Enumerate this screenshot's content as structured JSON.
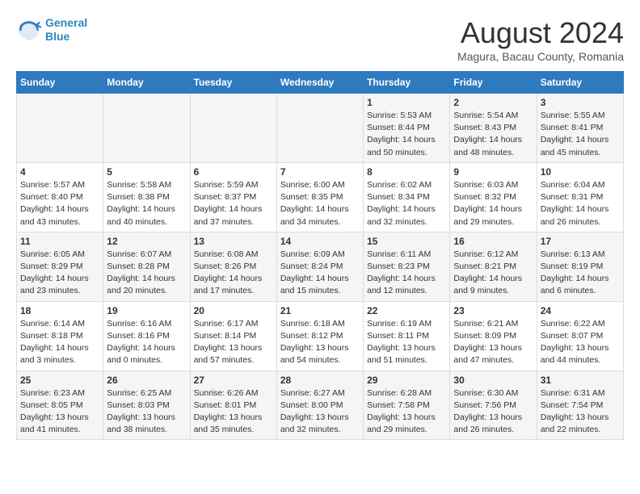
{
  "logo": {
    "line1": "General",
    "line2": "Blue"
  },
  "title": "August 2024",
  "subtitle": "Magura, Bacau County, Romania",
  "weekdays": [
    "Sunday",
    "Monday",
    "Tuesday",
    "Wednesday",
    "Thursday",
    "Friday",
    "Saturday"
  ],
  "weeks": [
    [
      {
        "day": "",
        "sunrise": "",
        "sunset": "",
        "daylight": ""
      },
      {
        "day": "",
        "sunrise": "",
        "sunset": "",
        "daylight": ""
      },
      {
        "day": "",
        "sunrise": "",
        "sunset": "",
        "daylight": ""
      },
      {
        "day": "",
        "sunrise": "",
        "sunset": "",
        "daylight": ""
      },
      {
        "day": "1",
        "sunrise": "Sunrise: 5:53 AM",
        "sunset": "Sunset: 8:44 PM",
        "daylight": "Daylight: 14 hours and 50 minutes."
      },
      {
        "day": "2",
        "sunrise": "Sunrise: 5:54 AM",
        "sunset": "Sunset: 8:43 PM",
        "daylight": "Daylight: 14 hours and 48 minutes."
      },
      {
        "day": "3",
        "sunrise": "Sunrise: 5:55 AM",
        "sunset": "Sunset: 8:41 PM",
        "daylight": "Daylight: 14 hours and 45 minutes."
      }
    ],
    [
      {
        "day": "4",
        "sunrise": "Sunrise: 5:57 AM",
        "sunset": "Sunset: 8:40 PM",
        "daylight": "Daylight: 14 hours and 43 minutes."
      },
      {
        "day": "5",
        "sunrise": "Sunrise: 5:58 AM",
        "sunset": "Sunset: 8:38 PM",
        "daylight": "Daylight: 14 hours and 40 minutes."
      },
      {
        "day": "6",
        "sunrise": "Sunrise: 5:59 AM",
        "sunset": "Sunset: 8:37 PM",
        "daylight": "Daylight: 14 hours and 37 minutes."
      },
      {
        "day": "7",
        "sunrise": "Sunrise: 6:00 AM",
        "sunset": "Sunset: 8:35 PM",
        "daylight": "Daylight: 14 hours and 34 minutes."
      },
      {
        "day": "8",
        "sunrise": "Sunrise: 6:02 AM",
        "sunset": "Sunset: 8:34 PM",
        "daylight": "Daylight: 14 hours and 32 minutes."
      },
      {
        "day": "9",
        "sunrise": "Sunrise: 6:03 AM",
        "sunset": "Sunset: 8:32 PM",
        "daylight": "Daylight: 14 hours and 29 minutes."
      },
      {
        "day": "10",
        "sunrise": "Sunrise: 6:04 AM",
        "sunset": "Sunset: 8:31 PM",
        "daylight": "Daylight: 14 hours and 26 minutes."
      }
    ],
    [
      {
        "day": "11",
        "sunrise": "Sunrise: 6:05 AM",
        "sunset": "Sunset: 8:29 PM",
        "daylight": "Daylight: 14 hours and 23 minutes."
      },
      {
        "day": "12",
        "sunrise": "Sunrise: 6:07 AM",
        "sunset": "Sunset: 8:28 PM",
        "daylight": "Daylight: 14 hours and 20 minutes."
      },
      {
        "day": "13",
        "sunrise": "Sunrise: 6:08 AM",
        "sunset": "Sunset: 8:26 PM",
        "daylight": "Daylight: 14 hours and 17 minutes."
      },
      {
        "day": "14",
        "sunrise": "Sunrise: 6:09 AM",
        "sunset": "Sunset: 8:24 PM",
        "daylight": "Daylight: 14 hours and 15 minutes."
      },
      {
        "day": "15",
        "sunrise": "Sunrise: 6:11 AM",
        "sunset": "Sunset: 8:23 PM",
        "daylight": "Daylight: 14 hours and 12 minutes."
      },
      {
        "day": "16",
        "sunrise": "Sunrise: 6:12 AM",
        "sunset": "Sunset: 8:21 PM",
        "daylight": "Daylight: 14 hours and 9 minutes."
      },
      {
        "day": "17",
        "sunrise": "Sunrise: 6:13 AM",
        "sunset": "Sunset: 8:19 PM",
        "daylight": "Daylight: 14 hours and 6 minutes."
      }
    ],
    [
      {
        "day": "18",
        "sunrise": "Sunrise: 6:14 AM",
        "sunset": "Sunset: 8:18 PM",
        "daylight": "Daylight: 14 hours and 3 minutes."
      },
      {
        "day": "19",
        "sunrise": "Sunrise: 6:16 AM",
        "sunset": "Sunset: 8:16 PM",
        "daylight": "Daylight: 14 hours and 0 minutes."
      },
      {
        "day": "20",
        "sunrise": "Sunrise: 6:17 AM",
        "sunset": "Sunset: 8:14 PM",
        "daylight": "Daylight: 13 hours and 57 minutes."
      },
      {
        "day": "21",
        "sunrise": "Sunrise: 6:18 AM",
        "sunset": "Sunset: 8:12 PM",
        "daylight": "Daylight: 13 hours and 54 minutes."
      },
      {
        "day": "22",
        "sunrise": "Sunrise: 6:19 AM",
        "sunset": "Sunset: 8:11 PM",
        "daylight": "Daylight: 13 hours and 51 minutes."
      },
      {
        "day": "23",
        "sunrise": "Sunrise: 6:21 AM",
        "sunset": "Sunset: 8:09 PM",
        "daylight": "Daylight: 13 hours and 47 minutes."
      },
      {
        "day": "24",
        "sunrise": "Sunrise: 6:22 AM",
        "sunset": "Sunset: 8:07 PM",
        "daylight": "Daylight: 13 hours and 44 minutes."
      }
    ],
    [
      {
        "day": "25",
        "sunrise": "Sunrise: 6:23 AM",
        "sunset": "Sunset: 8:05 PM",
        "daylight": "Daylight: 13 hours and 41 minutes."
      },
      {
        "day": "26",
        "sunrise": "Sunrise: 6:25 AM",
        "sunset": "Sunset: 8:03 PM",
        "daylight": "Daylight: 13 hours and 38 minutes."
      },
      {
        "day": "27",
        "sunrise": "Sunrise: 6:26 AM",
        "sunset": "Sunset: 8:01 PM",
        "daylight": "Daylight: 13 hours and 35 minutes."
      },
      {
        "day": "28",
        "sunrise": "Sunrise: 6:27 AM",
        "sunset": "Sunset: 8:00 PM",
        "daylight": "Daylight: 13 hours and 32 minutes."
      },
      {
        "day": "29",
        "sunrise": "Sunrise: 6:28 AM",
        "sunset": "Sunset: 7:58 PM",
        "daylight": "Daylight: 13 hours and 29 minutes."
      },
      {
        "day": "30",
        "sunrise": "Sunrise: 6:30 AM",
        "sunset": "Sunset: 7:56 PM",
        "daylight": "Daylight: 13 hours and 26 minutes."
      },
      {
        "day": "31",
        "sunrise": "Sunrise: 6:31 AM",
        "sunset": "Sunset: 7:54 PM",
        "daylight": "Daylight: 13 hours and 22 minutes."
      }
    ]
  ]
}
